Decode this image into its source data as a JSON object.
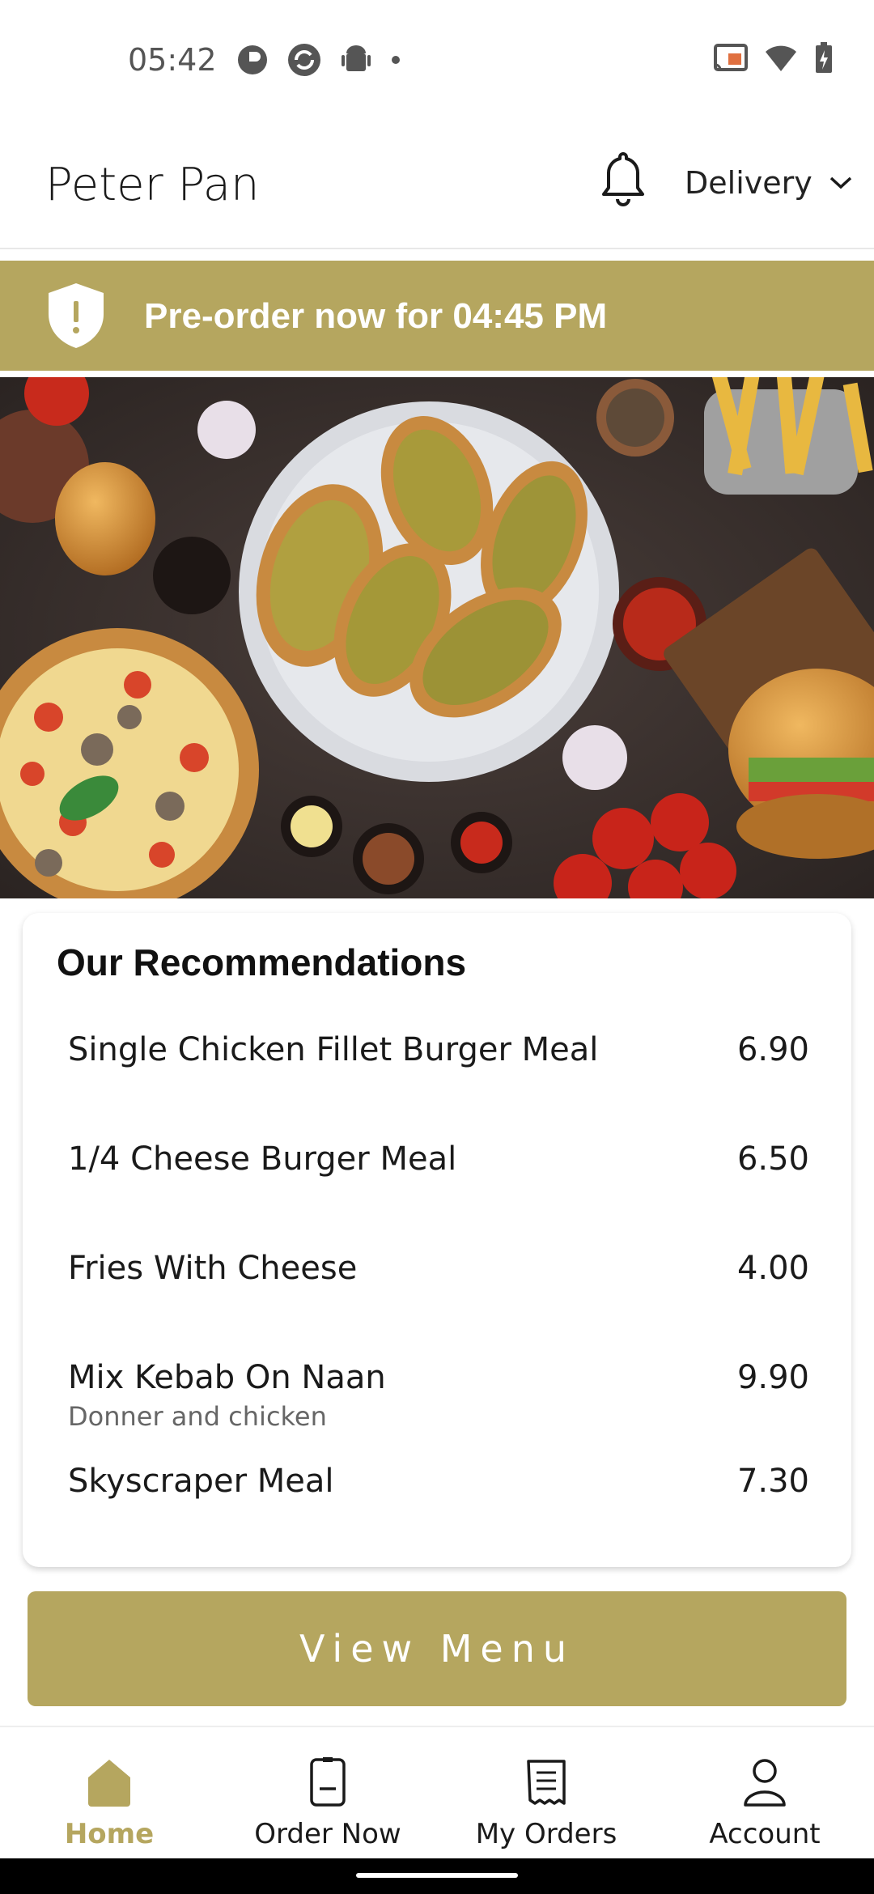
{
  "status_bar": {
    "time": "05:42"
  },
  "header": {
    "restaurant_name": "Peter Pan",
    "delivery_mode": "Delivery"
  },
  "banner": {
    "preorder_text": "Pre-order now for 04:45 PM"
  },
  "recommendations": {
    "title": "Our Recommendations",
    "items": [
      {
        "name": "Single Chicken Fillet Burger Meal",
        "price": "6.90",
        "description": ""
      },
      {
        "name": "1/4 Cheese Burger Meal",
        "price": "6.50",
        "description": ""
      },
      {
        "name": "Fries With Cheese",
        "price": "4.00",
        "description": ""
      },
      {
        "name": "Mix Kebab On Naan",
        "price": "9.90",
        "description": "Donner and chicken"
      },
      {
        "name": "Skyscraper Meal",
        "price": "7.30",
        "description": ""
      }
    ]
  },
  "view_menu": {
    "label": "View Menu"
  },
  "bottom_nav": {
    "items": [
      {
        "label": "Home",
        "icon": "home-icon",
        "active": true
      },
      {
        "label": "Order Now",
        "icon": "order-icon",
        "active": false
      },
      {
        "label": "My Orders",
        "icon": "receipt-icon",
        "active": false
      },
      {
        "label": "Account",
        "icon": "account-icon",
        "active": false
      }
    ]
  },
  "colors": {
    "accent": "#b5a65f",
    "text": "#1a1a1a"
  }
}
